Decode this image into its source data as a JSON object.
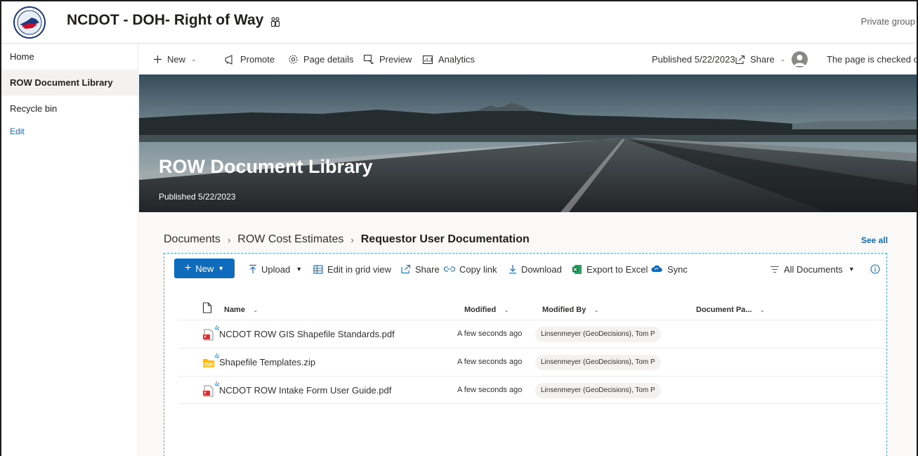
{
  "site": {
    "title": "NCDOT - DOH- Right of Way",
    "privacy": "Private group"
  },
  "leftnav": {
    "items": [
      {
        "label": "Home"
      },
      {
        "label": "ROW Document Library"
      },
      {
        "label": "Recycle bin"
      }
    ],
    "edit_label": "Edit"
  },
  "commandbar": {
    "new_label": "New",
    "promote_label": "Promote",
    "page_details_label": "Page details",
    "preview_label": "Preview",
    "analytics_label": "Analytics",
    "published": "Published 5/22/2023",
    "share_label": "Share",
    "checked_out": "The page is checked out"
  },
  "hero": {
    "title": "ROW Document Library",
    "published": "Published 5/22/2023"
  },
  "library": {
    "breadcrumb": [
      "Documents",
      "ROW Cost Estimates",
      "Requestor User Documentation"
    ],
    "see_all": "See all",
    "toolbar": {
      "new_label": "New",
      "upload_label": "Upload",
      "grid_label": "Edit in grid view",
      "share_label": "Share",
      "copy_link_label": "Copy link",
      "download_label": "Download",
      "export_label": "Export to Excel",
      "sync_label": "Sync",
      "view_label": "All Documents"
    },
    "columns": {
      "name": "Name",
      "modified": "Modified",
      "modified_by": "Modified By",
      "document_pa": "Document Pa..."
    },
    "rows": [
      {
        "name": "NCDOT ROW GIS Shapefile Standards.pdf",
        "type": "pdf-icon",
        "modified": "A few seconds ago",
        "modified_by": "Linsenmeyer (GeoDecisions), Tom P"
      },
      {
        "name": "Shapefile Templates.zip",
        "type": "zip-folder-icon",
        "modified": "A few seconds ago",
        "modified_by": "Linsenmeyer (GeoDecisions), Tom P"
      },
      {
        "name": "NCDOT ROW Intake Form User Guide.pdf",
        "type": "pdf-icon",
        "modified": "A few seconds ago",
        "modified_by": "Linsenmeyer (GeoDecisions), Tom P"
      }
    ]
  },
  "colors": {
    "accent": "#0f6cbd",
    "nav_active_bg": "#f3f2f1",
    "dashed_border": "#4aa3df"
  }
}
